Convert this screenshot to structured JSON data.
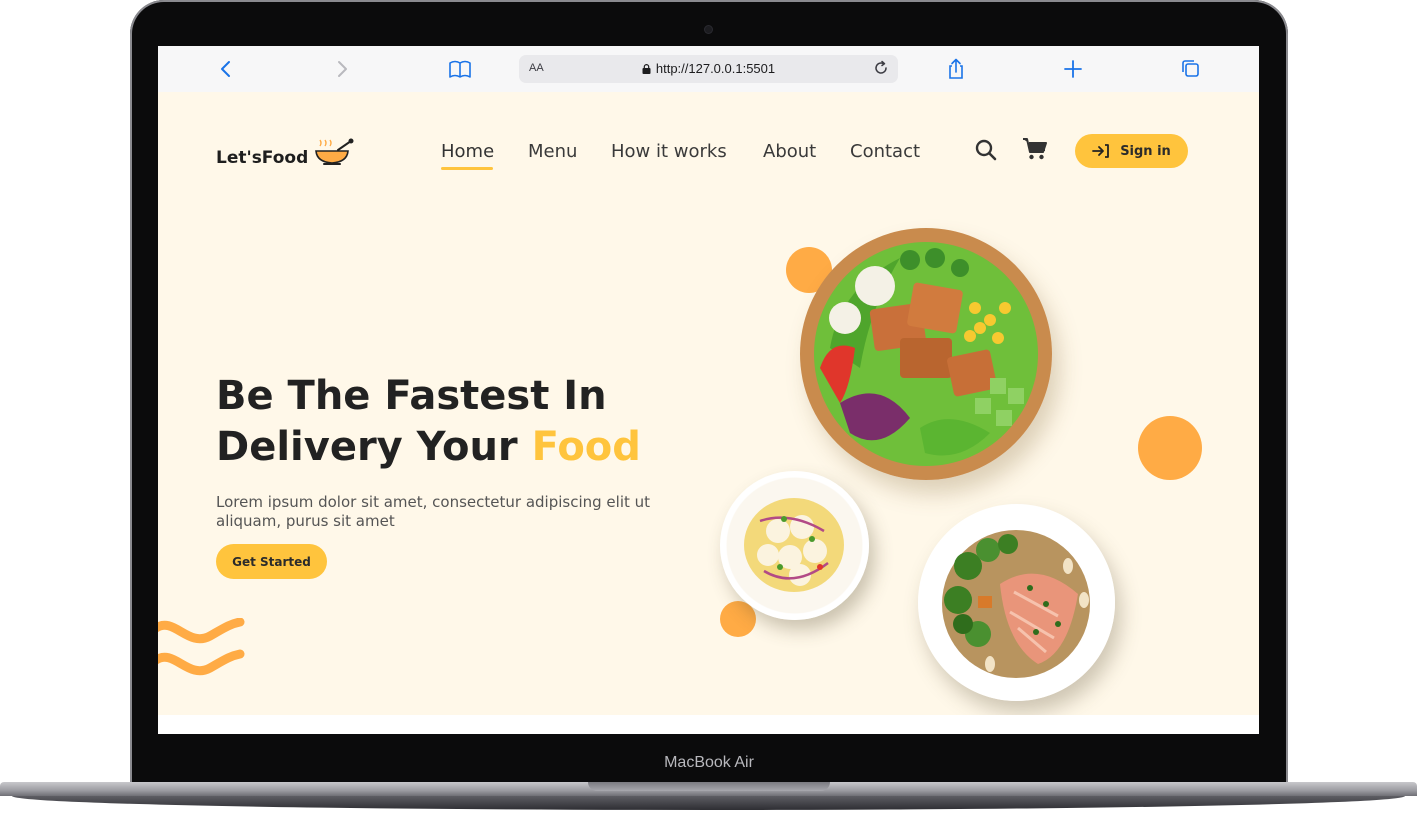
{
  "device": {
    "label": "MacBook Air"
  },
  "browser": {
    "text_size_label": "AA",
    "url": "http://127.0.0.1:5501"
  },
  "site": {
    "brand": "Let'sFood",
    "nav": [
      "Home",
      "Menu",
      "How it works",
      "About",
      "Contact"
    ],
    "active_nav": "Home",
    "signin_label": "Sign in",
    "headline_line1": "Be The Fastest In",
    "headline_line2": "Delivery Your",
    "headline_accent": "Food",
    "description": "Lorem ipsum dolor sit amet, consectetur adipiscing elit ut aliquam, purus sit amet",
    "cta_label": "Get Started"
  },
  "colors": {
    "accent": "#ffc43d",
    "decor_orange": "#ffab45",
    "page_background": "#fff8e9",
    "browser_link": "#1a73e8"
  },
  "icons": [
    "back-icon",
    "forward-icon",
    "bookmarks-icon",
    "lock-icon",
    "reload-icon",
    "share-icon",
    "new-tab-icon",
    "tabs-icon",
    "bowl-logo-icon",
    "search-icon",
    "cart-icon",
    "sign-in-icon"
  ]
}
